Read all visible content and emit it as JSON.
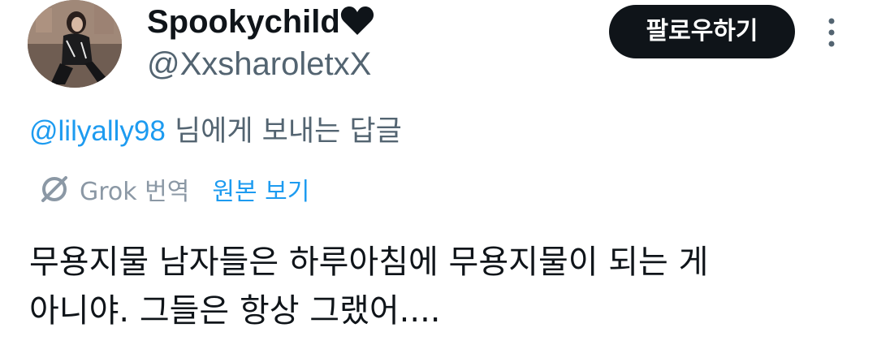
{
  "profile": {
    "display_name": "Spookychild",
    "display_name_emoji": "black-heart-icon",
    "handle": "@XxsharoletxX",
    "avatar": "profile-photo"
  },
  "actions": {
    "follow_label": "팔로우하기",
    "more_icon": "more-vertical-icon"
  },
  "reply_context": {
    "mention": "@lilyally98",
    "suffix": " 님에게 보내는 답글"
  },
  "translation": {
    "icon": "grok-icon",
    "label": "Grok 번역",
    "show_original_label": "원본 보기"
  },
  "tweet": {
    "lines": [
      "무용지물 남자들은 하루아침에 무용지물이 되는 게",
      "아니야. 그들은 항상 그랬어...."
    ]
  },
  "colors": {
    "text_primary": "#0f1419",
    "text_secondary": "#536471",
    "link_blue": "#1d9bf0",
    "button_bg": "#0f1419",
    "button_text": "#ffffff"
  }
}
